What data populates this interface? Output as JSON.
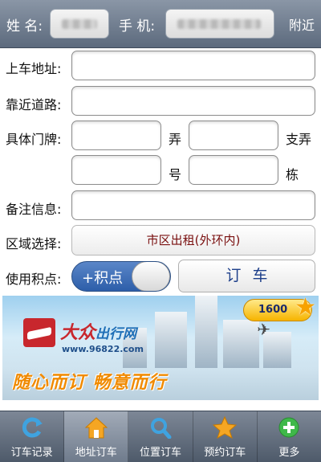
{
  "header": {
    "name_label": "姓 名:",
    "phone_label": "手 机:",
    "nearby_label": "附近"
  },
  "form": {
    "pickup_label": "上车地址:",
    "near_road_label": "靠近道路:",
    "door_label": "具体门牌:",
    "lane_unit": "弄",
    "branch_lane_unit": "支弄",
    "number_unit": "号",
    "building_unit": "栋",
    "note_label": "备注信息:",
    "area_label": "区域选择:",
    "area_value": "市区出租(外环内)",
    "points_label": "使用积点:",
    "points_toggle_text": "+积点",
    "order_button": "订车"
  },
  "banner": {
    "brand_main": "大众",
    "brand_sub": "出行网",
    "url": "www.96822.com",
    "slogan": "随心而订 畅意而行",
    "points_value": "1600"
  },
  "tabs": [
    {
      "label": "订车记录",
      "icon": "refresh-icon"
    },
    {
      "label": "地址订车",
      "icon": "home-icon"
    },
    {
      "label": "位置订车",
      "icon": "search-icon"
    },
    {
      "label": "预约订车",
      "icon": "star-icon"
    },
    {
      "label": "更多",
      "icon": "plus-icon"
    }
  ],
  "colors": {
    "header_bg": "#6b7788",
    "toggle_blue": "#2d5ea9",
    "area_text": "#7a1010",
    "order_text": "#1d3f8a"
  }
}
